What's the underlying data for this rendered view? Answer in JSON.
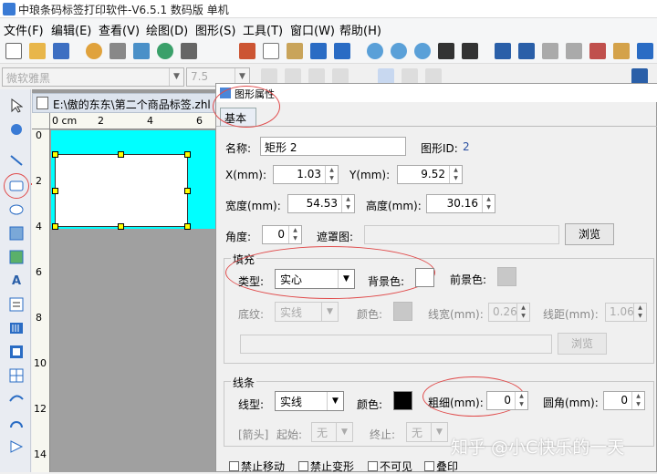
{
  "app_title": "中琅条码标签打印软件-V6.5.1 数码版 单机",
  "menu": [
    "文件(F)",
    "编辑(E)",
    "查看(V)",
    "绘图(D)",
    "图形(S)",
    "工具(T)",
    "窗口(W)",
    "帮助(H)"
  ],
  "format_bar": {
    "font_name": "微软雅黑",
    "font_size": "7.5"
  },
  "document": {
    "tab_title": "E:\\傲的东东\\第二个商品标签.zhl",
    "ruler_top": [
      "0 cm",
      "2",
      "4",
      "6"
    ],
    "ruler_left": [
      "0",
      "2",
      "4",
      "6",
      "8",
      "10",
      "12",
      "14"
    ]
  },
  "dialog": {
    "title": "图形属性",
    "tab": "基本",
    "name_label": "名称:",
    "name_value": "矩形 2",
    "id_label": "图形ID:",
    "id_value": "2",
    "x_label": "X(mm):",
    "x_value": "1.03",
    "y_label": "Y(mm):",
    "y_value": "9.52",
    "width_label": "宽度(mm):",
    "width_value": "54.53",
    "height_label": "高度(mm):",
    "height_value": "30.16",
    "angle_label": "角度:",
    "angle_value": "0",
    "mask_label": "遮罩图:",
    "browse": "浏览",
    "fill": {
      "group": "填充",
      "type_label": "类型:",
      "type_value": "实心",
      "bg_label": "背景色:",
      "fg_label": "前景色:",
      "pattern_label": "底纹:",
      "pattern_value": "实线",
      "color_label": "颜色:",
      "linewidth_label": "线宽(mm):",
      "linewidth_value": "0.26",
      "linespacing_label": "线距(mm):",
      "linespacing_value": "1.06",
      "browse": "浏览"
    },
    "line": {
      "group": "线条",
      "type_label": "线型:",
      "type_value": "实线",
      "color_label": "颜色:",
      "thickness_label": "粗细(mm):",
      "thickness_value": "0",
      "corner_label": "圆角(mm):",
      "corner_value": "0",
      "arrow_label": "[箭头]",
      "start_label": "起始:",
      "start_value": "无",
      "end_label": "终止:",
      "end_value": "无"
    },
    "checks": [
      "禁止移动",
      "禁止变形",
      "不可见",
      "叠印"
    ]
  },
  "watermark": "知乎 @小C快乐的一天",
  "colors": {
    "label_bg": "#00ffff",
    "highlight": "#e04b4b",
    "line_color": "#000000"
  }
}
